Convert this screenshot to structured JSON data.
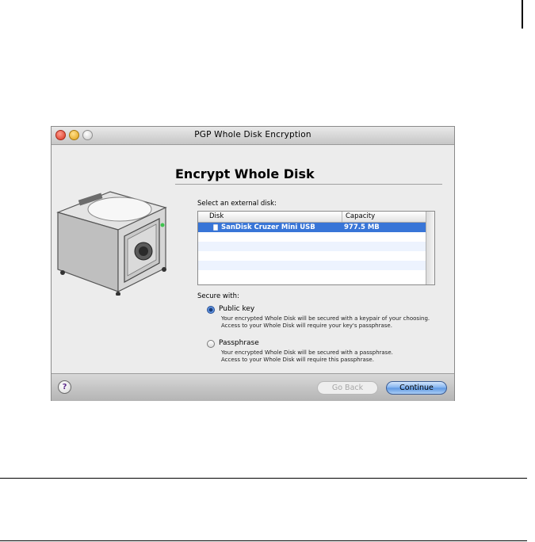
{
  "window": {
    "title": "PGP Whole Disk Encryption"
  },
  "main": {
    "heading": "Encrypt Whole Disk",
    "select_label": "Select an external disk:",
    "table": {
      "columns": [
        "Disk",
        "Capacity"
      ],
      "rows": [
        {
          "disk": "SanDisk Cruzer Mini USB",
          "capacity": "977.5 MB",
          "selected": true
        }
      ]
    },
    "secure_label": "Secure with:",
    "options": [
      {
        "title": "Public key",
        "selected": true,
        "desc1": "Your encrypted Whole Disk will be secured with a keypair of your choosing.",
        "desc2": "Access to your Whole Disk will require your key's passphrase."
      },
      {
        "title": "Passphrase",
        "selected": false,
        "desc1": "Your encrypted Whole Disk will be secured with a passphrase.",
        "desc2": "Access to your Whole Disk will require this passphrase."
      }
    ]
  },
  "footer": {
    "help_glyph": "?",
    "back_label": "Go Back",
    "continue_label": "Continue"
  },
  "icons": {
    "drive": "hard-drive-safe-icon",
    "help": "help-icon"
  },
  "colors": {
    "selection": "#3875d7",
    "accent": "#5d97e2"
  }
}
